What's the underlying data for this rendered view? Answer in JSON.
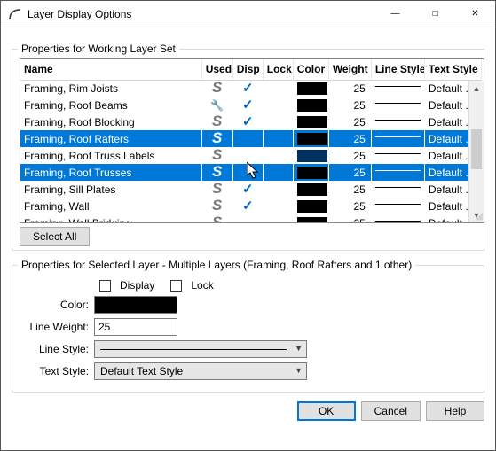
{
  "window": {
    "title": "Layer Display Options"
  },
  "group1_label": "Properties for  Working Layer Set",
  "columns": [
    "Name",
    "Used",
    "Disp",
    "Lock",
    "Color",
    "Weight",
    "Line Style",
    "Text Style"
  ],
  "rows": [
    {
      "name": "Framing, Rim Joists",
      "used": "S",
      "disp": true,
      "color": "#000",
      "weight": "25",
      "txt": "Default Te...",
      "sel": false
    },
    {
      "name": "Framing, Roof Beams",
      "used": "W",
      "disp": true,
      "color": "#000",
      "weight": "25",
      "txt": "Default Te...",
      "sel": false
    },
    {
      "name": "Framing, Roof Blocking",
      "used": "S",
      "disp": true,
      "color": "#000",
      "weight": "25",
      "txt": "Default Te...",
      "sel": false
    },
    {
      "name": "Framing, Roof Rafters",
      "used": "S",
      "disp": false,
      "color": "#000",
      "weight": "25",
      "txt": "Default Te...",
      "sel": true
    },
    {
      "name": "Framing, Roof Truss Labels",
      "used": "S",
      "disp": false,
      "color": "#003060",
      "weight": "25",
      "txt": "Default ...",
      "sel": false
    },
    {
      "name": "Framing, Roof Trusses",
      "used": "S",
      "disp": false,
      "color": "#000",
      "weight": "25",
      "txt": "Default Te...",
      "sel": true
    },
    {
      "name": "Framing, Sill Plates",
      "used": "S",
      "disp": true,
      "color": "#000",
      "weight": "25",
      "txt": "Default Te...",
      "sel": false
    },
    {
      "name": "Framing, Wall",
      "used": "S",
      "disp": true,
      "color": "#000",
      "weight": "25",
      "txt": "Default Te...",
      "sel": false
    },
    {
      "name": "Framing, Wall Bridging",
      "used": "S",
      "disp": false,
      "color": "#000",
      "weight": "25",
      "txt": "Default Te...",
      "sel": false
    }
  ],
  "select_all_label": "Select All",
  "group2_label": "Properties for Selected Layer - Multiple Layers (Framing, Roof Rafters and 1 other)",
  "form": {
    "display_label": "Display",
    "lock_label": "Lock",
    "color_label": "Color:",
    "weight_label": "Line Weight:",
    "weight_value": "25",
    "line_style_label": "Line Style:",
    "text_style_label": "Text Style:",
    "text_style_value": "Default Text Style"
  },
  "buttons": {
    "ok": "OK",
    "cancel": "Cancel",
    "help": "Help"
  }
}
